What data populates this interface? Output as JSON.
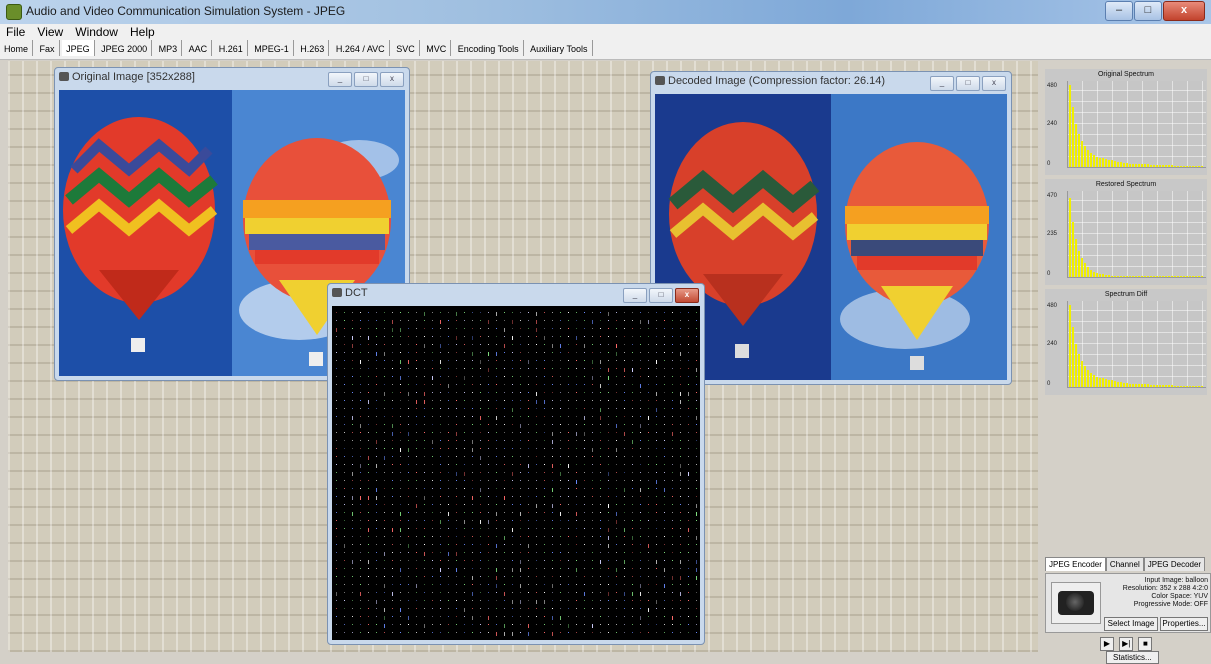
{
  "app": {
    "title": "Audio and Video Communication Simulation System - JPEG"
  },
  "window_buttons": {
    "minimize": "–",
    "maximize": "□",
    "close": "x"
  },
  "menu": [
    "File",
    "View",
    "Window",
    "Help"
  ],
  "tabs": [
    "Home",
    "Fax",
    "JPEG",
    "JPEG 2000",
    "MP3",
    "AAC",
    "H.261",
    "MPEG-1",
    "H.263",
    "H.264 / AVC",
    "SVC",
    "MVC",
    "Encoding Tools",
    "Auxiliary Tools"
  ],
  "active_tab": "JPEG",
  "windows": {
    "original": {
      "title": "Original Image [352x288]"
    },
    "decoded": {
      "title": "Decoded Image (Compression factor: 26.14)"
    },
    "dct": {
      "title": "DCT"
    }
  },
  "spectra": [
    {
      "title": "Original Spectrum",
      "yticks": [
        "480",
        "240",
        "0"
      ]
    },
    {
      "title": "Restored Spectrum",
      "yticks": [
        "470",
        "235",
        "0"
      ]
    },
    {
      "title": "Spectrum Diff",
      "yticks": [
        "480",
        "240",
        "0"
      ]
    }
  ],
  "encoder_tabs": [
    "JPEG Encoder",
    "Channel",
    "JPEG Decoder"
  ],
  "encoder_info": {
    "input": "Input Image: balloon",
    "resolution": "Resolution: 352 x 288  4:2:0",
    "color": "Color Space: YUV",
    "progressive": "Progressive Mode: OFF"
  },
  "buttons": {
    "select_image": "Select Image",
    "properties": "Properties...",
    "statistics": "Statistics..."
  },
  "controls": [
    "▶",
    "▶|",
    "■"
  ],
  "colors": {
    "spectrum_bar": "#f0f000",
    "dct_bg": "#000000"
  }
}
